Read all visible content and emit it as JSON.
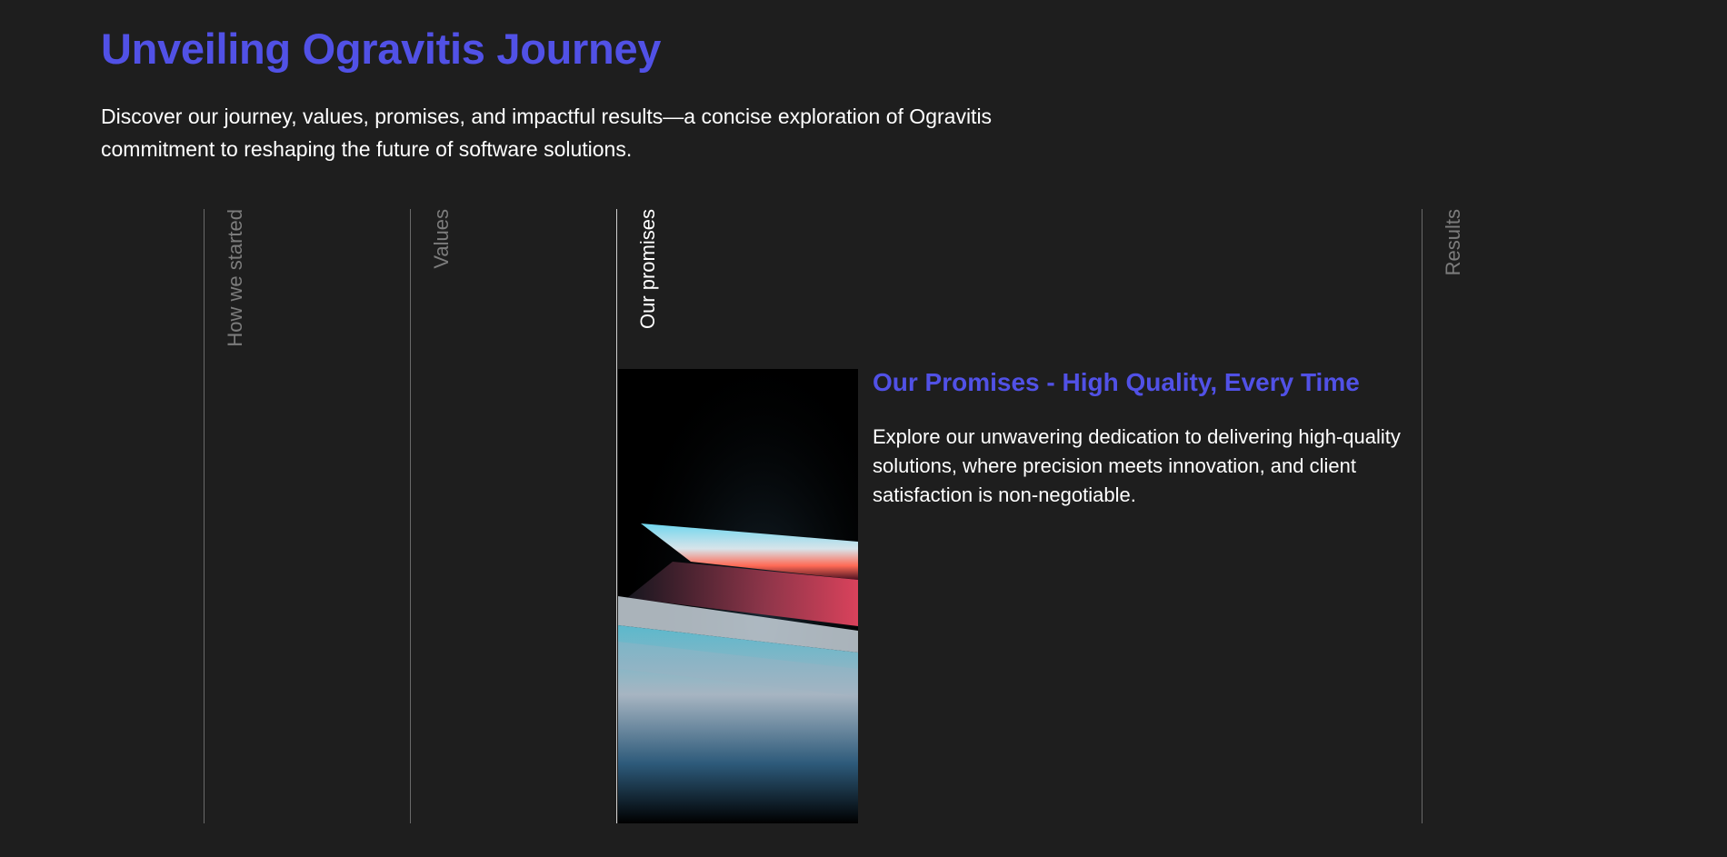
{
  "header": {
    "title": "Unveiling Ogravitis Journey",
    "intro": "Discover our journey, values, promises, and impactful results—a concise exploration of Ogravitis commitment to reshaping the future of software solutions."
  },
  "tabs": [
    {
      "label": "How we started",
      "active": false
    },
    {
      "label": "Values",
      "active": false
    },
    {
      "label": "Our promises",
      "active": true
    },
    {
      "label": "Results",
      "active": false
    }
  ],
  "active_panel": {
    "heading": "Our Promises - High Quality, Every Time",
    "body": "Explore our unwavering dedication to delivering high-quality solutions, where precision meets innovation, and client satisfaction is non-negotiable.",
    "image": "laptop-glow-photo"
  },
  "colors": {
    "accent": "#5151e6",
    "background": "#1e1e1e",
    "text": "#ffffff",
    "muted": "#7c7c7c"
  }
}
